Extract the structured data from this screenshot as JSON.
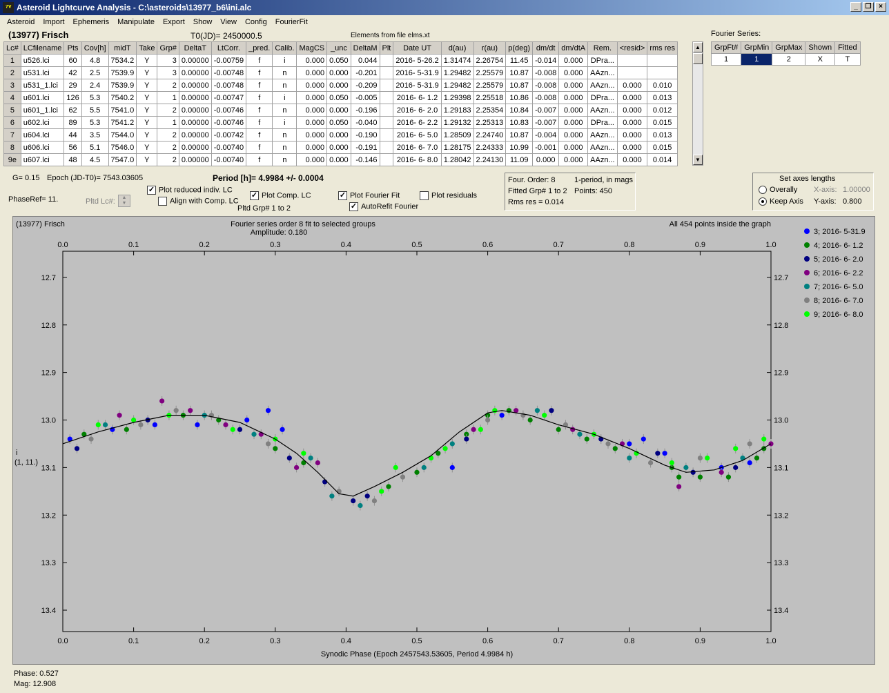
{
  "window": {
    "title": "Asteroid Lightcurve Analysis - C:\\asteroids\\13977_b6\\ini.alc",
    "app_icon": "⁷ᵛ"
  },
  "menu": [
    "Asteroid",
    "Import",
    "Ephemeris",
    "Manipulate",
    "Export",
    "Show",
    "View",
    "Config",
    "FourierFit"
  ],
  "header": {
    "asteroid": "(13977) Frisch",
    "t0": "T0(JD)= 2450000.5",
    "elements": "Elements from file elms.xt"
  },
  "table": {
    "columns": [
      "Lc#",
      "LCfilename",
      "Pts",
      "Cov[h]",
      "midT",
      "Take",
      "Grp#",
      "DeltaT",
      "LtCorr.",
      "_pred.",
      "Calib.",
      "MagCS",
      "_unc",
      "DeltaM",
      "Plt",
      "Date UT",
      "d(au)",
      "r(au)",
      "p(deg)",
      "dm/dt",
      "dm/dtA",
      "Rem.",
      "<resid>",
      "rms res"
    ],
    "rows": [
      [
        "1",
        "u526.lci",
        "60",
        "4.8",
        "7534.2",
        "Y",
        "3",
        "0.00000",
        "-0.00759",
        "f",
        "i",
        "0.000",
        "0.050",
        "0.044",
        "",
        "2016- 5-26.2",
        "1.31474",
        "2.26754",
        "11.45",
        "-0.014",
        "0.000",
        "DPra...",
        "",
        ""
      ],
      [
        "2",
        "u531.lci",
        "42",
        "2.5",
        "7539.9",
        "Y",
        "3",
        "0.00000",
        "-0.00748",
        "f",
        "n",
        "0.000",
        "0.000",
        "-0.201",
        "",
        "2016- 5-31.9",
        "1.29482",
        "2.25579",
        "10.87",
        "-0.008",
        "0.000",
        "AAzn...",
        "",
        ""
      ],
      [
        "3",
        "u531_1.lci",
        "29",
        "2.4",
        "7539.9",
        "Y",
        "2",
        "0.00000",
        "-0.00748",
        "f",
        "n",
        "0.000",
        "0.000",
        "-0.209",
        "",
        "2016- 5-31.9",
        "1.29482",
        "2.25579",
        "10.87",
        "-0.008",
        "0.000",
        "AAzn...",
        "0.000",
        "0.010"
      ],
      [
        "4",
        "u601.lci",
        "126",
        "5.3",
        "7540.2",
        "Y",
        "1",
        "0.00000",
        "-0.00747",
        "f",
        "i",
        "0.000",
        "0.050",
        "-0.005",
        "",
        "2016- 6- 1.2",
        "1.29398",
        "2.25518",
        "10.86",
        "-0.008",
        "0.000",
        "DPra...",
        "0.000",
        "0.013"
      ],
      [
        "5",
        "u601_1.lci",
        "62",
        "5.5",
        "7541.0",
        "Y",
        "2",
        "0.00000",
        "-0.00746",
        "f",
        "n",
        "0.000",
        "0.000",
        "-0.196",
        "",
        "2016- 6- 2.0",
        "1.29183",
        "2.25354",
        "10.84",
        "-0.007",
        "0.000",
        "AAzn...",
        "0.000",
        "0.012"
      ],
      [
        "6",
        "u602.lci",
        "89",
        "5.3",
        "7541.2",
        "Y",
        "1",
        "0.00000",
        "-0.00746",
        "f",
        "i",
        "0.000",
        "0.050",
        "-0.040",
        "",
        "2016- 6- 2.2",
        "1.29132",
        "2.25313",
        "10.83",
        "-0.007",
        "0.000",
        "DPra...",
        "0.000",
        "0.015"
      ],
      [
        "7",
        "u604.lci",
        "44",
        "3.5",
        "7544.0",
        "Y",
        "2",
        "0.00000",
        "-0.00742",
        "f",
        "n",
        "0.000",
        "0.000",
        "-0.190",
        "",
        "2016- 6- 5.0",
        "1.28509",
        "2.24740",
        "10.87",
        "-0.004",
        "0.000",
        "AAzn...",
        "0.000",
        "0.013"
      ],
      [
        "8",
        "u606.lci",
        "56",
        "5.1",
        "7546.0",
        "Y",
        "2",
        "0.00000",
        "-0.00740",
        "f",
        "n",
        "0.000",
        "0.000",
        "-0.191",
        "",
        "2016- 6- 7.0",
        "1.28175",
        "2.24333",
        "10.99",
        "-0.001",
        "0.000",
        "AAzn...",
        "0.000",
        "0.015"
      ],
      [
        "9e",
        "u607.lci",
        "48",
        "4.5",
        "7547.0",
        "Y",
        "2",
        "0.00000",
        "-0.00740",
        "f",
        "n",
        "0.000",
        "0.000",
        "-0.146",
        "",
        "2016- 6- 8.0",
        "1.28042",
        "2.24130",
        "11.09",
        "0.000",
        "0.000",
        "AAzn...",
        "0.000",
        "0.014"
      ]
    ]
  },
  "fourier_series": {
    "label": "Fourier Series:",
    "columns": [
      "GrpFt#",
      "GrpMin",
      "GrpMax",
      "Shown",
      "Fitted"
    ],
    "row": [
      "1",
      "1",
      "2",
      "X",
      "T"
    ]
  },
  "controls": {
    "g": "G= 0.15",
    "epoch": "Epoch (JD-T0)= 7543.03605",
    "period": "Period [h]= 4.9984 +/- 0.0004",
    "phaseref": "PhaseRef= 11.",
    "pltd_lc": "Pltd Lc#:",
    "plot_reduced": "Plot reduced indiv. LC",
    "align_comp": "Align with Comp. LC",
    "plot_comp": "Plot Comp. LC",
    "pltd_grp": "Pltd Grp#  1  to  2",
    "plot_fourier": "Plot Fourier Fit",
    "autorefit": "AutoRefit Fourier",
    "plot_residuals": "Plot residuals",
    "four_order": "Four. Order:  8",
    "one_period": "1-period, in mags",
    "fitted_grp": "Fitted Grp# 1 to 2",
    "points": "Points: 450",
    "rms_res": "Rms res     = 0.014",
    "axes_title": "Set axes lengths",
    "overally": "Overally",
    "keep_axis": "Keep Axis",
    "x_axis_label": "X-axis:",
    "x_axis_value": "1.00000",
    "y_axis_label": "Y-axis:",
    "y_axis_value": "0.800"
  },
  "status": {
    "phase": "Phase:  0.527",
    "mag": "Mag:   12.908"
  },
  "chart_data": {
    "type": "scatter",
    "title_left": "(13977) Frisch",
    "title": "Fourier series order 8 fit to selected groups",
    "subtitle": "Amplitude: 0.180",
    "note": "All 454 points inside the graph",
    "xlabel": "Synodic Phase (Epoch 2457543.53605, Period 4.9984 h)",
    "ylabel": "i",
    "ylabel2": "(1, 11.)",
    "xlim": [
      0,
      1
    ],
    "ylim": [
      12.645,
      13.445
    ],
    "y_inverted": true,
    "x_ticks": [
      "0.0",
      "0.1",
      "0.2",
      "0.3",
      "0.4",
      "0.5",
      "0.6",
      "0.7",
      "0.8",
      "0.9",
      "1.0"
    ],
    "y_ticks": [
      "12.7",
      "12.8",
      "12.9",
      "13.0",
      "13.1",
      "13.2",
      "13.3",
      "13.4"
    ],
    "fit_curve": [
      [
        0.0,
        13.05
      ],
      [
        0.05,
        13.025
      ],
      [
        0.1,
        13.005
      ],
      [
        0.15,
        12.99
      ],
      [
        0.2,
        12.99
      ],
      [
        0.25,
        13.005
      ],
      [
        0.3,
        13.04
      ],
      [
        0.33,
        13.07
      ],
      [
        0.36,
        13.11
      ],
      [
        0.39,
        13.155
      ],
      [
        0.41,
        13.16
      ],
      [
        0.44,
        13.14
      ],
      [
        0.48,
        13.11
      ],
      [
        0.52,
        13.075
      ],
      [
        0.56,
        13.025
      ],
      [
        0.6,
        12.985
      ],
      [
        0.62,
        12.98
      ],
      [
        0.66,
        12.99
      ],
      [
        0.7,
        13.01
      ],
      [
        0.75,
        13.03
      ],
      [
        0.8,
        13.06
      ],
      [
        0.85,
        13.095
      ],
      [
        0.88,
        13.11
      ],
      [
        0.92,
        13.105
      ],
      [
        0.96,
        13.085
      ],
      [
        1.0,
        13.05
      ]
    ],
    "series": [
      {
        "name": "3; 2016- 5-31.9",
        "color": "#0000ff",
        "points": [
          [
            0.01,
            13.04
          ],
          [
            0.07,
            13.02
          ],
          [
            0.13,
            13.01
          ],
          [
            0.19,
            13.01
          ],
          [
            0.26,
            13.0
          ],
          [
            0.29,
            12.98
          ],
          [
            0.31,
            13.02
          ],
          [
            0.55,
            13.1
          ],
          [
            0.62,
            12.99
          ],
          [
            0.8,
            13.05
          ],
          [
            0.82,
            13.04
          ],
          [
            0.85,
            13.07
          ],
          [
            0.93,
            13.1
          ],
          [
            0.97,
            13.09
          ]
        ]
      },
      {
        "name": "4; 2016- 6- 1.2",
        "color": "#008000",
        "points": [
          [
            0.03,
            13.03
          ],
          [
            0.09,
            13.02
          ],
          [
            0.17,
            12.99
          ],
          [
            0.22,
            13.0
          ],
          [
            0.3,
            13.06
          ],
          [
            0.34,
            13.09
          ],
          [
            0.46,
            13.14
          ],
          [
            0.5,
            13.11
          ],
          [
            0.53,
            13.07
          ],
          [
            0.57,
            13.03
          ],
          [
            0.6,
            12.99
          ],
          [
            0.63,
            12.98
          ],
          [
            0.66,
            13.0
          ],
          [
            0.7,
            13.02
          ],
          [
            0.74,
            13.04
          ],
          [
            0.78,
            13.06
          ],
          [
            0.86,
            13.1
          ],
          [
            0.87,
            13.12
          ],
          [
            0.9,
            13.12
          ],
          [
            0.94,
            13.12
          ],
          [
            0.98,
            13.08
          ],
          [
            0.99,
            13.06
          ]
        ]
      },
      {
        "name": "5; 2016- 6- 2.0",
        "color": "#000080",
        "points": [
          [
            0.02,
            13.06
          ],
          [
            0.12,
            13.0
          ],
          [
            0.25,
            13.02
          ],
          [
            0.32,
            13.08
          ],
          [
            0.37,
            13.13
          ],
          [
            0.41,
            13.17
          ],
          [
            0.43,
            13.16
          ],
          [
            0.57,
            13.04
          ],
          [
            0.69,
            12.98
          ],
          [
            0.76,
            13.04
          ],
          [
            0.84,
            13.07
          ],
          [
            0.89,
            13.11
          ],
          [
            0.95,
            13.1
          ]
        ]
      },
      {
        "name": "6; 2016- 6- 2.2",
        "color": "#800080",
        "points": [
          [
            0.08,
            12.99
          ],
          [
            0.14,
            12.96
          ],
          [
            0.18,
            12.98
          ],
          [
            0.23,
            13.01
          ],
          [
            0.28,
            13.03
          ],
          [
            0.33,
            13.1
          ],
          [
            0.36,
            13.09
          ],
          [
            0.58,
            13.02
          ],
          [
            0.64,
            12.98
          ],
          [
            0.72,
            13.02
          ],
          [
            0.79,
            13.05
          ],
          [
            0.87,
            13.14
          ],
          [
            0.93,
            13.11
          ],
          [
            1.0,
            13.05
          ]
        ]
      },
      {
        "name": "7; 2016- 6- 5.0",
        "color": "#008080",
        "points": [
          [
            0.06,
            13.01
          ],
          [
            0.2,
            12.99
          ],
          [
            0.27,
            13.03
          ],
          [
            0.35,
            13.08
          ],
          [
            0.38,
            13.16
          ],
          [
            0.42,
            13.18
          ],
          [
            0.51,
            13.1
          ],
          [
            0.55,
            13.05
          ],
          [
            0.67,
            12.98
          ],
          [
            0.73,
            13.03
          ],
          [
            0.8,
            13.08
          ],
          [
            0.88,
            13.1
          ],
          [
            0.96,
            13.08
          ]
        ]
      },
      {
        "name": "8; 2016- 6- 7.0",
        "color": "#808080",
        "points": [
          [
            0.04,
            13.04
          ],
          [
            0.11,
            13.01
          ],
          [
            0.16,
            12.98
          ],
          [
            0.21,
            12.99
          ],
          [
            0.29,
            13.05
          ],
          [
            0.39,
            13.15
          ],
          [
            0.44,
            13.17
          ],
          [
            0.48,
            13.12
          ],
          [
            0.6,
            13.0
          ],
          [
            0.65,
            12.99
          ],
          [
            0.71,
            13.01
          ],
          [
            0.77,
            13.05
          ],
          [
            0.83,
            13.09
          ],
          [
            0.9,
            13.08
          ],
          [
            0.97,
            13.05
          ]
        ]
      },
      {
        "name": "9; 2016- 6- 8.0",
        "color": "#00ff00",
        "points": [
          [
            0.05,
            13.01
          ],
          [
            0.1,
            13.0
          ],
          [
            0.15,
            12.99
          ],
          [
            0.24,
            13.02
          ],
          [
            0.3,
            13.04
          ],
          [
            0.34,
            13.07
          ],
          [
            0.45,
            13.15
          ],
          [
            0.47,
            13.1
          ],
          [
            0.52,
            13.08
          ],
          [
            0.54,
            13.06
          ],
          [
            0.59,
            13.02
          ],
          [
            0.61,
            12.98
          ],
          [
            0.68,
            12.99
          ],
          [
            0.75,
            13.03
          ],
          [
            0.81,
            13.07
          ],
          [
            0.86,
            13.09
          ],
          [
            0.91,
            13.08
          ],
          [
            0.95,
            13.06
          ],
          [
            0.99,
            13.04
          ]
        ]
      }
    ]
  }
}
